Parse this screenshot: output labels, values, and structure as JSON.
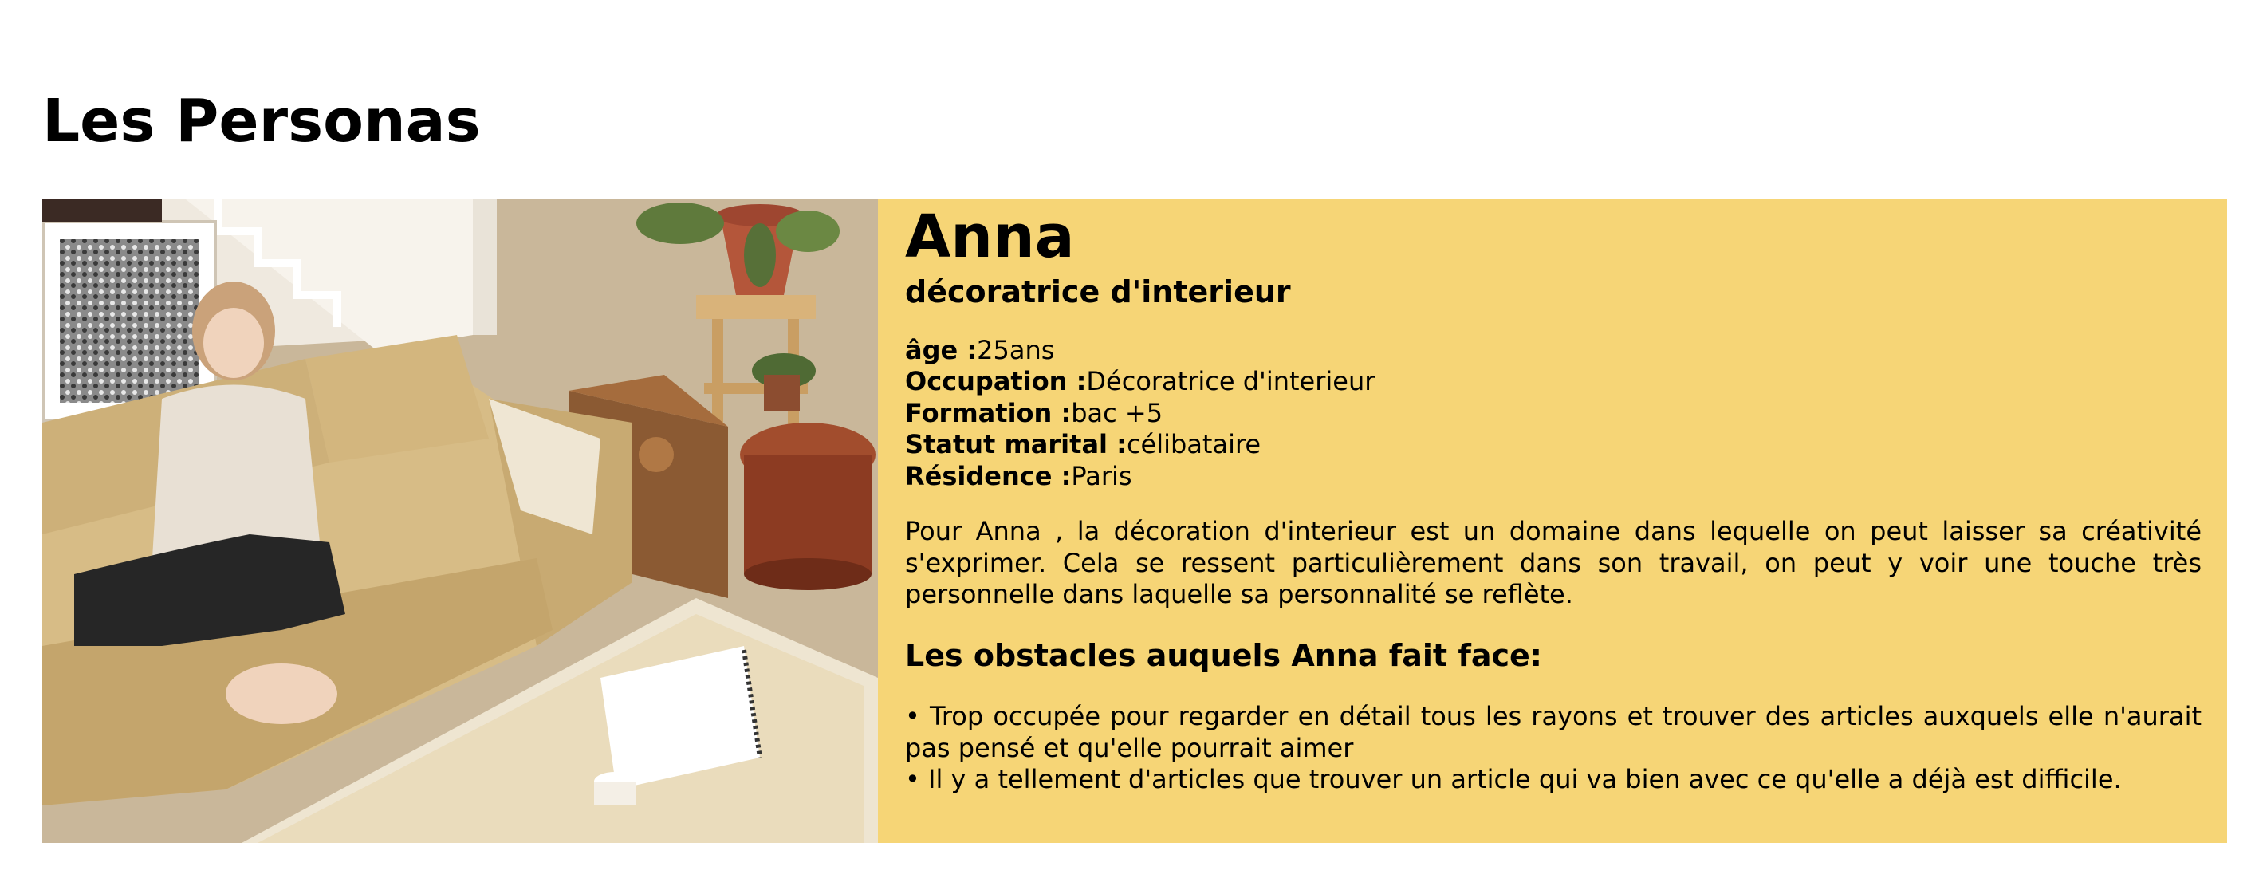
{
  "page": {
    "title": "Les Personas"
  },
  "persona": {
    "name": "Anna",
    "role": "décoratrice d'interieur",
    "facts": [
      {
        "label": "âge :",
        "value": "25ans"
      },
      {
        "label": "Occupation :",
        "value": "Décoratrice d'interieur"
      },
      {
        "label": "Formation :",
        "value": "bac +5"
      },
      {
        "label": "Statut marital :",
        "value": "célibataire"
      },
      {
        "label": "Résidence :",
        "value": "Paris"
      }
    ],
    "description": "Pour Anna , la décoration d'interieur est un domaine dans lequelle on peut laisser sa créativité s'exprimer. Cela se ressent particulièrement dans son travail, on peut y voir une touche très personnelle dans laquelle sa personnalité se reflète.",
    "obstacles_title": "Les obstacles auquels Anna fait face:",
    "obstacles": [
      "Trop occupée pour regarder en détail tous les rayons et trouver des articles auxquels elle n'aurait pas pensé et qu'elle pourrait aimer",
      "Il y a tellement d'articles que trouver un article qui va bien avec ce qu'elle a déjà est difficile."
    ],
    "card_color": "#f6d576"
  }
}
